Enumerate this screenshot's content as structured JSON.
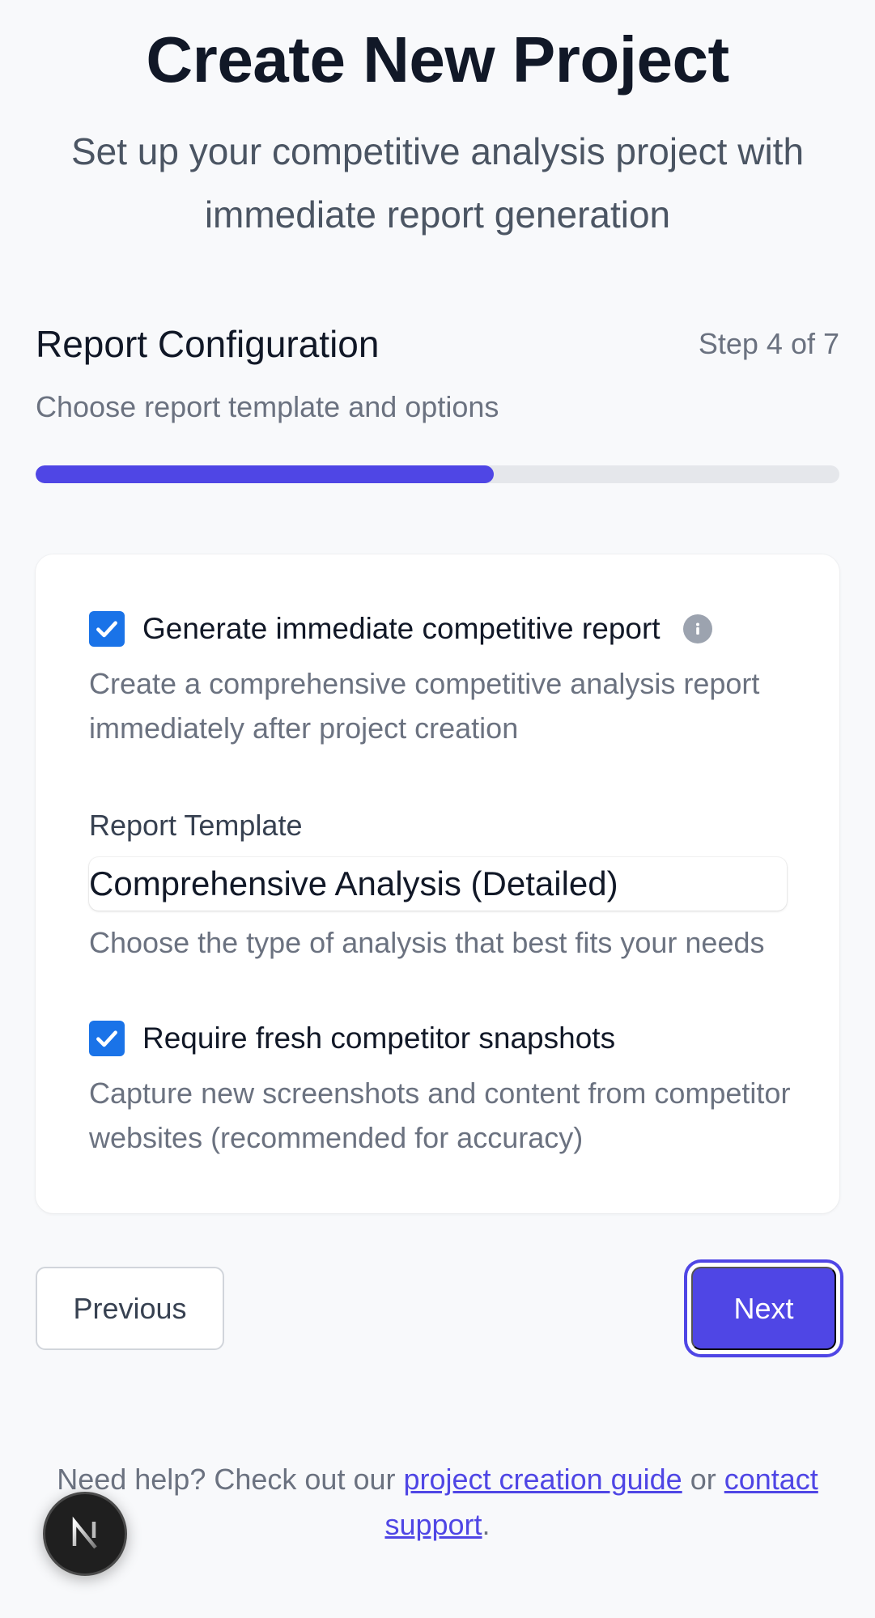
{
  "header": {
    "title": "Create New Project",
    "subtitle": "Set up your competitive analysis project with immediate report generation"
  },
  "step": {
    "title": "Report Configuration",
    "counter": "Step 4 of 7",
    "description": "Choose report template and options",
    "progress_percent": 57
  },
  "form": {
    "immediate_report": {
      "label": "Generate immediate competitive report",
      "checked": true,
      "help": "Create a comprehensive competitive analysis report immediately after project creation"
    },
    "template": {
      "label": "Report Template",
      "value": "Comprehensive Analysis (Detailed)",
      "help": "Choose the type of analysis that best fits your needs"
    },
    "fresh_snapshots": {
      "label": "Require fresh competitor snapshots",
      "checked": true,
      "help": "Capture new screenshots and content from competitor websites (recommended for accuracy)"
    }
  },
  "nav": {
    "previous_label": "Previous",
    "next_label": "Next"
  },
  "footer": {
    "text_before": "Need help? Check out our ",
    "guide_link": "project creation guide",
    "text_middle": " or ",
    "support_link": "contact support",
    "text_after": "."
  },
  "colors": {
    "accent": "#4f46e5",
    "checkbox": "#1a73e8"
  },
  "icons": {
    "info": "info-icon",
    "check": "check-icon",
    "dev_badge": "nextjs-logo-icon"
  }
}
